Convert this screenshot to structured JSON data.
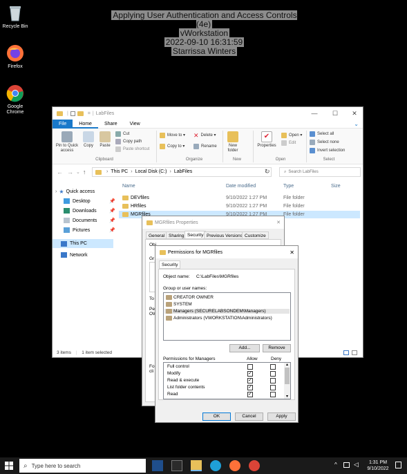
{
  "desktop": {
    "icons": [
      {
        "label": "Recycle Bin",
        "icon": "recycle-bin-icon"
      },
      {
        "label": "Firefox",
        "icon": "firefox-icon"
      },
      {
        "label": "Google Chrome",
        "icon": "chrome-icon"
      }
    ]
  },
  "overlay": {
    "line1": "Applying User Authentication and Access Controls (4e)",
    "line2": "vWorkstation",
    "line3": "2022-09-10 16:31:59",
    "line4": "Starrissa Winters"
  },
  "explorer": {
    "title": "LabFiles",
    "tabs": [
      "File",
      "Home",
      "Share",
      "View"
    ],
    "ribbon": {
      "pin": "Pin to Quick access",
      "copy": "Copy",
      "paste": "Paste",
      "cut": "Cut",
      "copy_path": "Copy path",
      "paste_shortcut": "Paste shortcut",
      "move_to": "Move to",
      "copy_to": "Copy to",
      "delete": "Delete",
      "rename": "Rename",
      "new_folder": "New folder",
      "properties": "Properties",
      "open": "Open",
      "edit": "Edit",
      "select_all": "Select all",
      "select_none": "Select none",
      "invert_selection": "Invert selection",
      "groups": {
        "clipboard": "Clipboard",
        "organize": "Organize",
        "new": "New",
        "open": "Open",
        "select": "Select"
      }
    },
    "path": [
      "This PC",
      "Local Disk (C:)",
      "LabFiles"
    ],
    "search_placeholder": "Search LabFiles",
    "nav": {
      "quick_access": "Quick access",
      "desktop": "Desktop",
      "downloads": "Downloads",
      "documents": "Documents",
      "pictures": "Pictures",
      "this_pc": "This PC",
      "network": "Network"
    },
    "columns": {
      "name": "Name",
      "date": "Date modified",
      "type": "Type",
      "size": "Size"
    },
    "files": [
      {
        "name": "DEVfiles",
        "date": "9/10/2022 1:27 PM",
        "type": "File folder"
      },
      {
        "name": "HRfiles",
        "date": "9/10/2022 1:27 PM",
        "type": "File folder"
      },
      {
        "name": "MGRfiles",
        "date": "9/10/2022 1:27 PM",
        "type": "File folder"
      }
    ],
    "status_items": "3 items",
    "status_selected": "1 item selected"
  },
  "properties_dialog": {
    "title": "MGRfiles Properties",
    "tabs": [
      "General",
      "Sharing",
      "Security",
      "Previous Versions",
      "Customize"
    ],
    "obj_partial": "Object name:   C:\\LabFiles\\MGRfiles",
    "partial_labels": {
      "gr": "Gr",
      "to": "To",
      "pe": "Pe",
      "ow": "OW",
      "fo": "Fo",
      "cli": "cli"
    }
  },
  "permissions_dialog": {
    "title": "Permissions for MGRfiles",
    "tab": "Security",
    "object_label": "Object name:",
    "object_value": "C:\\LabFiles\\MGRfiles",
    "group_label": "Group or user names:",
    "users": [
      "CREATOR OWNER",
      "SYSTEM",
      "Managers (SECURELABSONDEM\\Managers)",
      "Administrators (VWORKSTATION\\Administrators)"
    ],
    "add_button": "Add...",
    "remove_button": "Remove",
    "perm_label": "Permissions for Managers",
    "allow_label": "Allow",
    "deny_label": "Deny",
    "permissions": [
      {
        "name": "Full control",
        "allow": false,
        "deny": false
      },
      {
        "name": "Modify",
        "allow": true,
        "deny": false
      },
      {
        "name": "Read & execute",
        "allow": true,
        "deny": false
      },
      {
        "name": "List folder contents",
        "allow": true,
        "deny": false
      },
      {
        "name": "Read",
        "allow": true,
        "deny": false
      }
    ],
    "ok": "OK",
    "cancel": "Cancel",
    "apply": "Apply"
  },
  "taskbar": {
    "search_placeholder": "Type here to search",
    "time": "1:31 PM",
    "date": "9/10/2022"
  }
}
